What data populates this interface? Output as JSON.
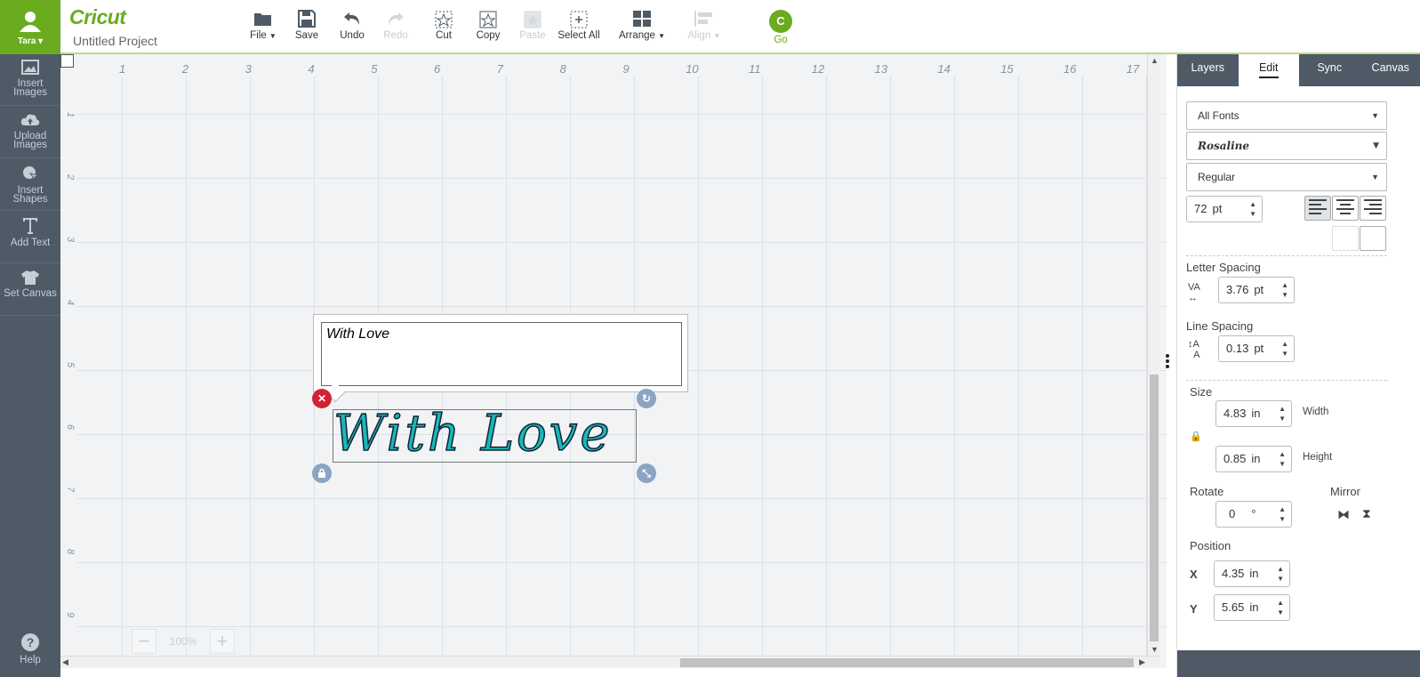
{
  "user": {
    "name": "Tara"
  },
  "sidebar": {
    "items": [
      {
        "label_line1": "Insert",
        "label_line2": "Images",
        "icon": "image-icon"
      },
      {
        "label_line1": "Upload",
        "label_line2": "Images",
        "icon": "cloud-upload-icon"
      },
      {
        "label_line1": "Insert",
        "label_line2": "Shapes",
        "icon": "shapes-icon"
      },
      {
        "label_line1": "Add Text",
        "label_line2": "",
        "icon": "text-icon"
      },
      {
        "label_line1": "Set Canvas",
        "label_line2": "",
        "icon": "shirt-icon"
      }
    ],
    "help": "Help"
  },
  "header": {
    "logo": "Cricut",
    "project": "Untitled Project",
    "toolbar": {
      "file": "File",
      "save": "Save",
      "undo": "Undo",
      "redo": "Redo",
      "cut": "Cut",
      "copy": "Copy",
      "paste": "Paste",
      "select_all": "Select All",
      "arrange": "Arrange",
      "align": "Align",
      "go": "Go",
      "go_glyph": "C"
    }
  },
  "canvas": {
    "ruler_top": [
      "1",
      "2",
      "3",
      "4",
      "5",
      "6",
      "7",
      "8",
      "9",
      "10",
      "11",
      "12",
      "13",
      "14",
      "15",
      "16",
      "17"
    ],
    "ruler_left": [
      "1",
      "2",
      "3",
      "4",
      "5",
      "6",
      "7",
      "8",
      "9"
    ],
    "zoom": "100%",
    "text_input_value": "With Love",
    "rendered_text": "With Love"
  },
  "panel": {
    "tabs": [
      "Layers",
      "Edit",
      "Sync",
      "Canvas"
    ],
    "font_filter": "All Fonts",
    "font": "Rosaline",
    "style": "Regular",
    "font_size": "72",
    "font_size_unit": "pt",
    "letter_spacing_label": "Letter Spacing",
    "letter_spacing": "3.76",
    "line_spacing_label": "Line Spacing",
    "line_spacing": "0.13",
    "pt": "pt",
    "size_label": "Size",
    "width": "4.83",
    "width_label": "Width",
    "height": "0.85",
    "height_label": "Height",
    "in": "in",
    "rotate_label": "Rotate",
    "rotate": "0",
    "degree": "°",
    "mirror_label": "Mirror",
    "position_label": "Position",
    "x_label": "X",
    "x": "4.35",
    "y_label": "Y",
    "y": "5.65"
  },
  "colors": {
    "brand": "#6aab20",
    "sidebar": "#4e5a66",
    "text_fill": "#19b8b8",
    "delete": "#d32236"
  }
}
